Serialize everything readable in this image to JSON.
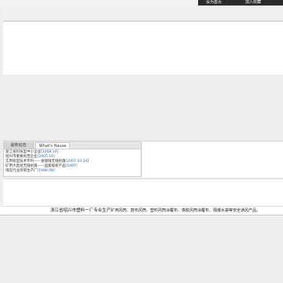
{
  "topnav": {
    "home_label": "设为首页",
    "favorite_label": "加入收藏"
  },
  "news": {
    "tabs": [
      {
        "label": "最新动态"
      },
      {
        "label": "What's Hause"
      }
    ],
    "items": [
      {
        "text": "浙江省科技型中小企业",
        "date": "[2008.10]"
      },
      {
        "text": "绍兴市重要民营企业",
        "date": "[2005.10]"
      },
      {
        "text": "实用新型技术专利——速缝缝无缝抗菌",
        "date": "[2007-10-24]"
      },
      {
        "text": "矿用大直径无缝抗菌——国家级新产品",
        "date": "[1997]"
      },
      {
        "text": "煤炭行业风筒生产厂",
        "date": "[1999.08]"
      }
    ]
  },
  "footer": {
    "company": "浙江省绍兴市塑料一厂专业生产",
    "products": "矿用风筒、鼓布风筒、塑料风筒涂覆布、橡胶风筒涂覆布、隔爆水袋等安全通风产品。"
  }
}
